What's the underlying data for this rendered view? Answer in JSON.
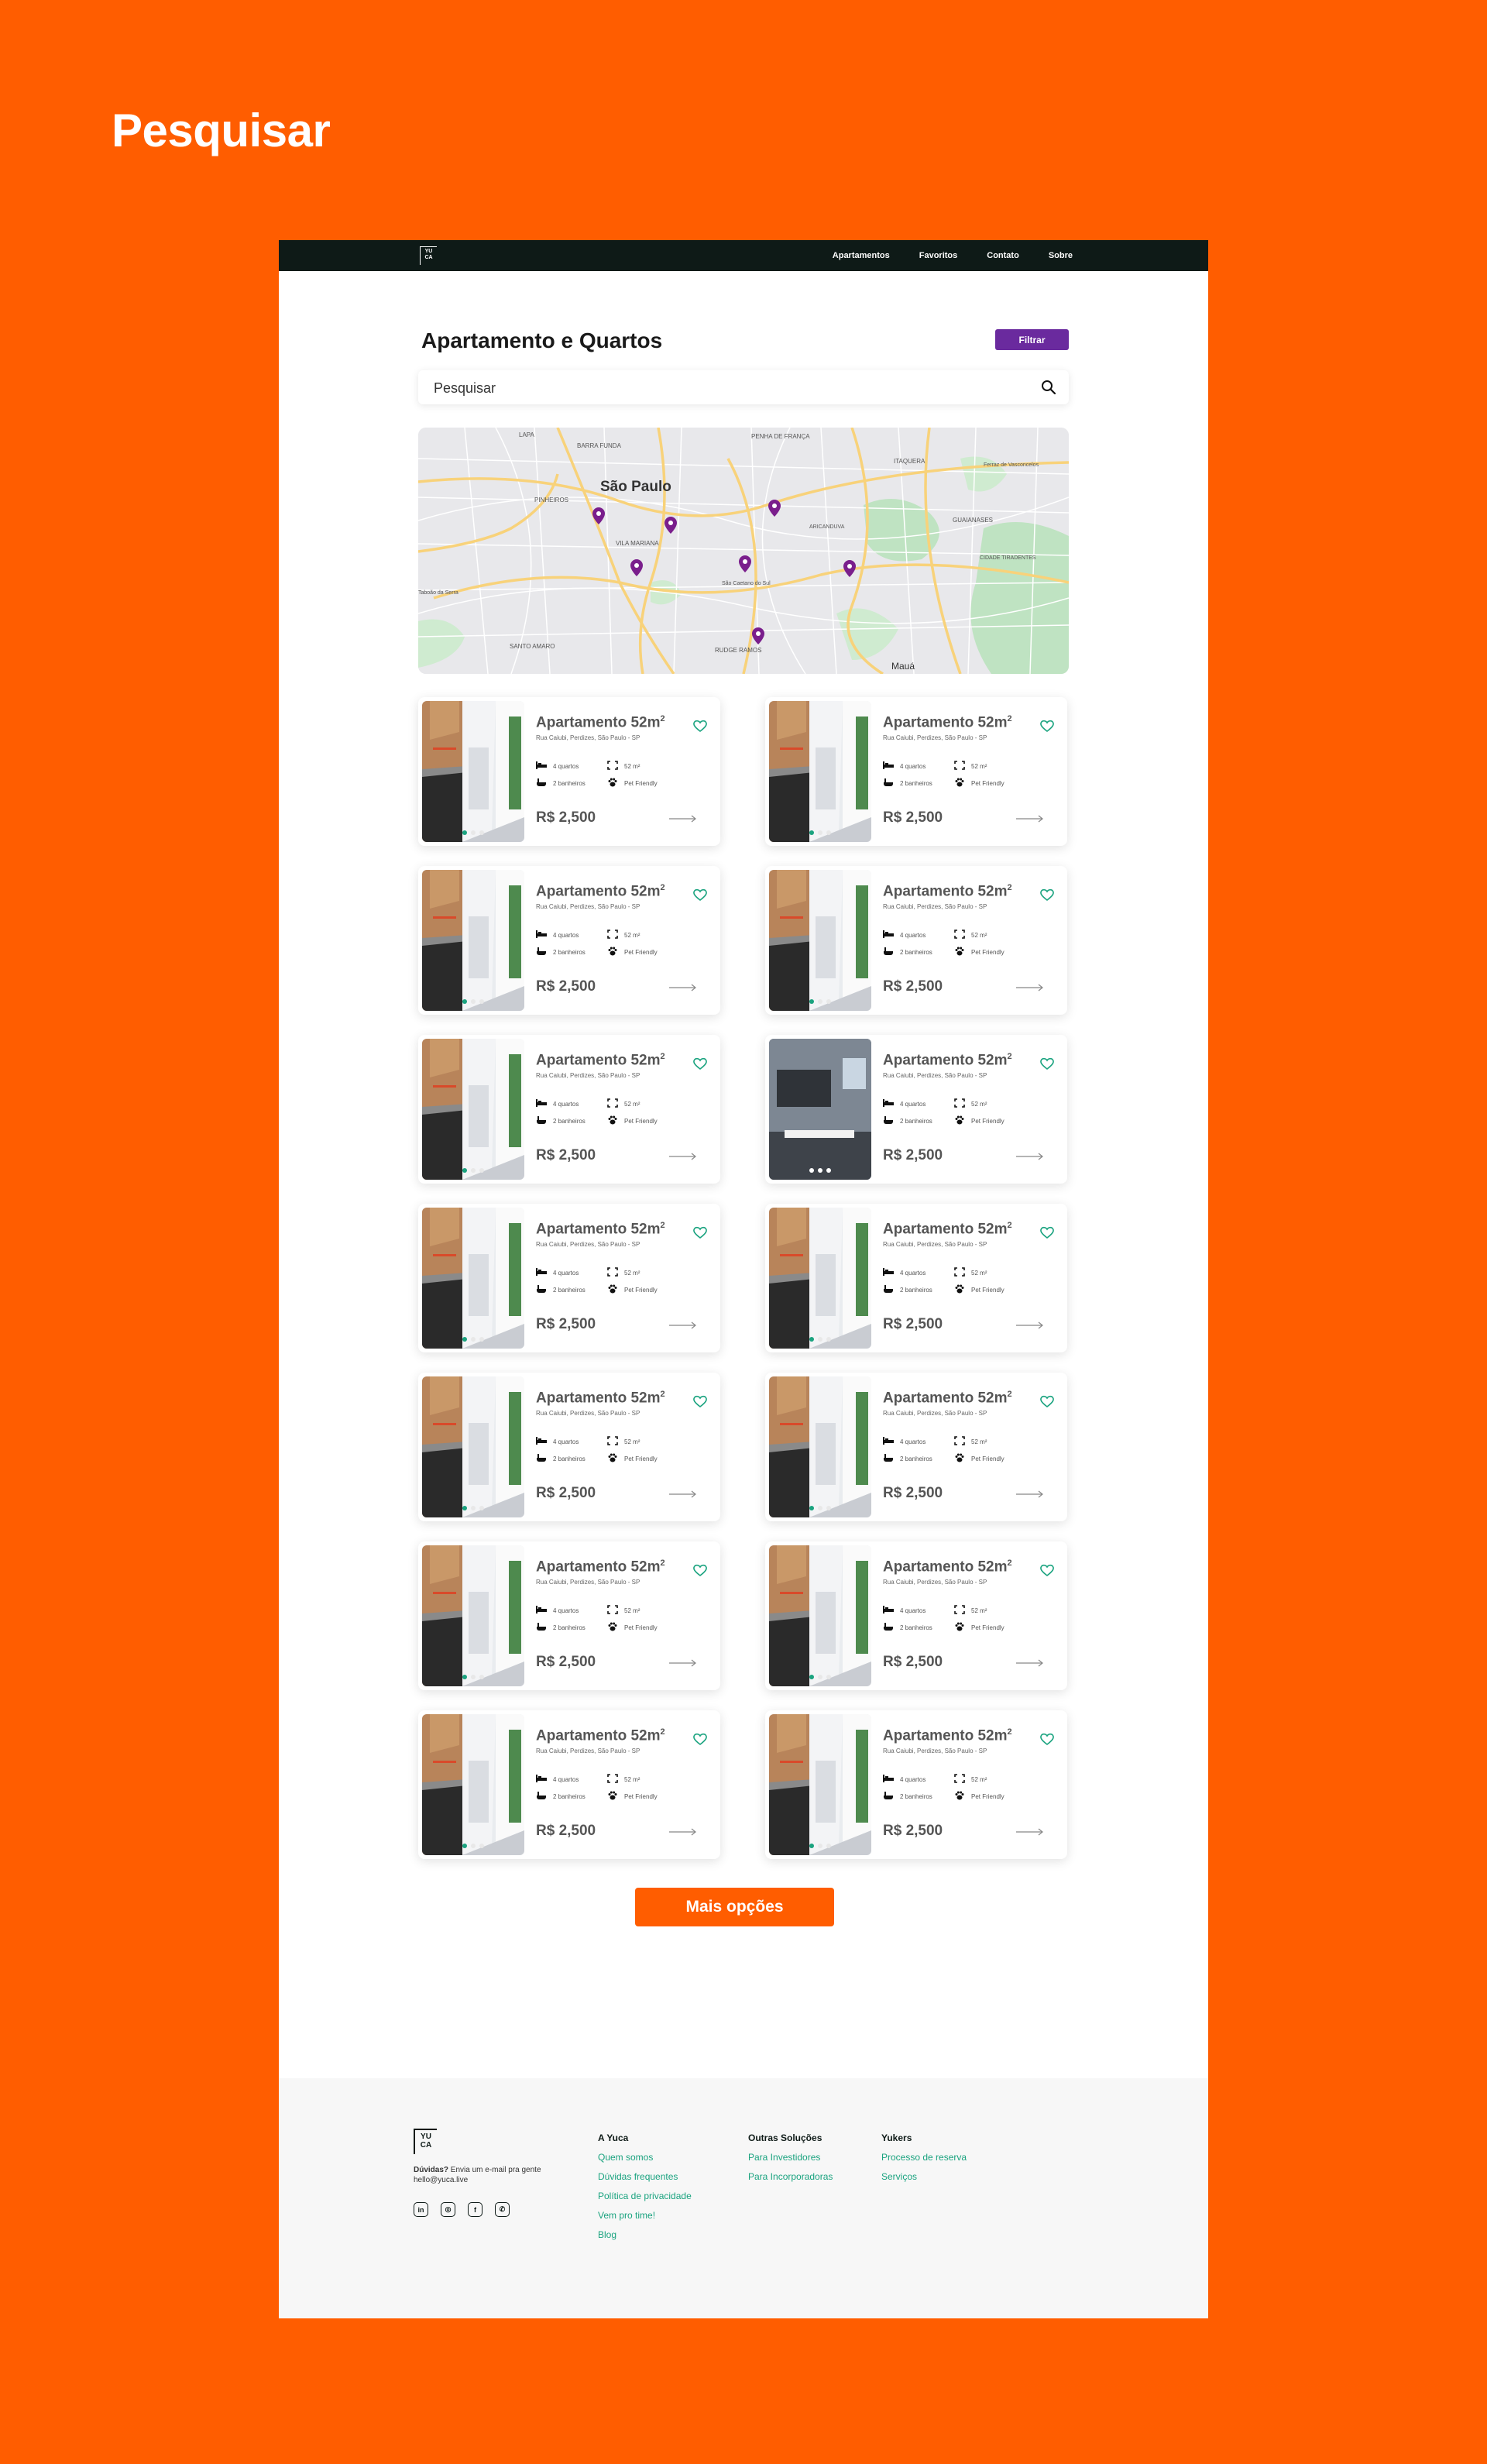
{
  "page": {
    "heading": "Pesquisar"
  },
  "nav": {
    "logo_top": "YU",
    "logo_bottom": "CA",
    "items": [
      "Apartamentos",
      "Favoritos",
      "Contato",
      "Sobre"
    ]
  },
  "main": {
    "title": "Apartamento e Quartos",
    "filter_label": "Filtrar",
    "search_placeholder": "Pesquisar",
    "map": {
      "labels": [
        "São Paulo",
        "LAPA",
        "BARRA FUNDA",
        "PENHA DE FRANÇA",
        "ITAQUERA",
        "PINHEIROS",
        "VILA MARIANA",
        "ARICANDUVA",
        "GUAIANASES",
        "CIDADE TIRADENTES",
        "SANTO AMARO",
        "RUDGE RAMOS",
        "Mauá",
        "São Caetano do Sul",
        "Taboão da Serra",
        "Ferraz de Vasconcelos"
      ]
    }
  },
  "listings": [
    {
      "name": "Apartamento 52m",
      "sup": "2",
      "address": "Rua Caiubi, Perdizes, São Paulo - SP",
      "rooms": "4 quartos",
      "area": "52 m²",
      "baths": "2 banheiros",
      "pet": "Pet Friendly",
      "price": "R$ 2,500",
      "photo": "kitchen"
    },
    {
      "name": "Apartamento 52m",
      "sup": "2",
      "address": "Rua Caiubi, Perdizes, São Paulo - SP",
      "rooms": "4 quartos",
      "area": "52 m²",
      "baths": "2 banheiros",
      "pet": "Pet Friendly",
      "price": "R$ 2,500",
      "photo": "kitchen"
    },
    {
      "name": "Apartamento 52m",
      "sup": "2",
      "address": "Rua Caiubi, Perdizes, São Paulo - SP",
      "rooms": "4 quartos",
      "area": "52 m²",
      "baths": "2 banheiros",
      "pet": "Pet Friendly",
      "price": "R$ 2,500",
      "photo": "kitchen"
    },
    {
      "name": "Apartamento 52m",
      "sup": "2",
      "address": "Rua Caiubi, Perdizes, São Paulo - SP",
      "rooms": "4 quartos",
      "area": "52 m²",
      "baths": "2 banheiros",
      "pet": "Pet Friendly",
      "price": "R$ 2,500",
      "photo": "kitchen"
    },
    {
      "name": "Apartamento 52m",
      "sup": "2",
      "address": "Rua Caiubi, Perdizes, São Paulo - SP",
      "rooms": "4 quartos",
      "area": "52 m²",
      "baths": "2 banheiros",
      "pet": "Pet Friendly",
      "price": "R$ 2,500",
      "photo": "kitchen"
    },
    {
      "name": "Apartamento 52m",
      "sup": "2",
      "address": "Rua Caiubi, Perdizes, São Paulo - SP",
      "rooms": "4 quartos",
      "area": "52 m²",
      "baths": "2 banheiros",
      "pet": "Pet Friendly",
      "price": "R$ 2,500",
      "photo": "living"
    },
    {
      "name": "Apartamento 52m",
      "sup": "2",
      "address": "Rua Caiubi, Perdizes, São Paulo - SP",
      "rooms": "4 quartos",
      "area": "52 m²",
      "baths": "2 banheiros",
      "pet": "Pet Friendly",
      "price": "R$ 2,500",
      "photo": "kitchen"
    },
    {
      "name": "Apartamento 52m",
      "sup": "2",
      "address": "Rua Caiubi, Perdizes, São Paulo - SP",
      "rooms": "4 quartos",
      "area": "52 m²",
      "baths": "2 banheiros",
      "pet": "Pet Friendly",
      "price": "R$ 2,500",
      "photo": "kitchen"
    },
    {
      "name": "Apartamento 52m",
      "sup": "2",
      "address": "Rua Caiubi, Perdizes, São Paulo - SP",
      "rooms": "4 quartos",
      "area": "52 m²",
      "baths": "2 banheiros",
      "pet": "Pet Friendly",
      "price": "R$ 2,500",
      "photo": "kitchen"
    },
    {
      "name": "Apartamento 52m",
      "sup": "2",
      "address": "Rua Caiubi, Perdizes, São Paulo - SP",
      "rooms": "4 quartos",
      "area": "52 m²",
      "baths": "2 banheiros",
      "pet": "Pet Friendly",
      "price": "R$ 2,500",
      "photo": "kitchen"
    },
    {
      "name": "Apartamento 52m",
      "sup": "2",
      "address": "Rua Caiubi, Perdizes, São Paulo - SP",
      "rooms": "4 quartos",
      "area": "52 m²",
      "baths": "2 banheiros",
      "pet": "Pet Friendly",
      "price": "R$ 2,500",
      "photo": "kitchen"
    },
    {
      "name": "Apartamento 52m",
      "sup": "2",
      "address": "Rua Caiubi, Perdizes, São Paulo - SP",
      "rooms": "4 quartos",
      "area": "52 m²",
      "baths": "2 banheiros",
      "pet": "Pet Friendly",
      "price": "R$ 2,500",
      "photo": "kitchen"
    },
    {
      "name": "Apartamento 52m",
      "sup": "2",
      "address": "Rua Caiubi, Perdizes, São Paulo - SP",
      "rooms": "4 quartos",
      "area": "52 m²",
      "baths": "2 banheiros",
      "pet": "Pet Friendly",
      "price": "R$ 2,500",
      "photo": "kitchen"
    },
    {
      "name": "Apartamento 52m",
      "sup": "2",
      "address": "Rua Caiubi, Perdizes, São Paulo - SP",
      "rooms": "4 quartos",
      "area": "52 m²",
      "baths": "2 banheiros",
      "pet": "Pet Friendly",
      "price": "R$ 2,500",
      "photo": "kitchen"
    }
  ],
  "more_label": "Mais opções",
  "footer": {
    "logo_top": "YU",
    "logo_bottom": "CA",
    "doubt_bold": "Dúvidas?",
    "doubt_text": " Envia um e-mail pra gente",
    "email": "hello@yuca.live",
    "socials": [
      "in",
      "◎",
      "f",
      "✆"
    ],
    "columns": [
      {
        "title": "A Yuca",
        "links": [
          "Quem somos",
          "Dúvidas frequentes",
          "Política de privacidade",
          "Vem pro time!",
          "Blog"
        ]
      },
      {
        "title": "Outras Soluções",
        "links": [
          "Para Investidores",
          "Para Incorporadoras"
        ]
      },
      {
        "title": "Yukers",
        "links": [
          "Processo de reserva",
          "Serviços"
        ]
      }
    ]
  },
  "colors": {
    "brand_orange": "#FF5D00",
    "nav_dark": "#0E1A17",
    "accent_purple": "#6A2A9E",
    "accent_green": "#1AA37F"
  }
}
